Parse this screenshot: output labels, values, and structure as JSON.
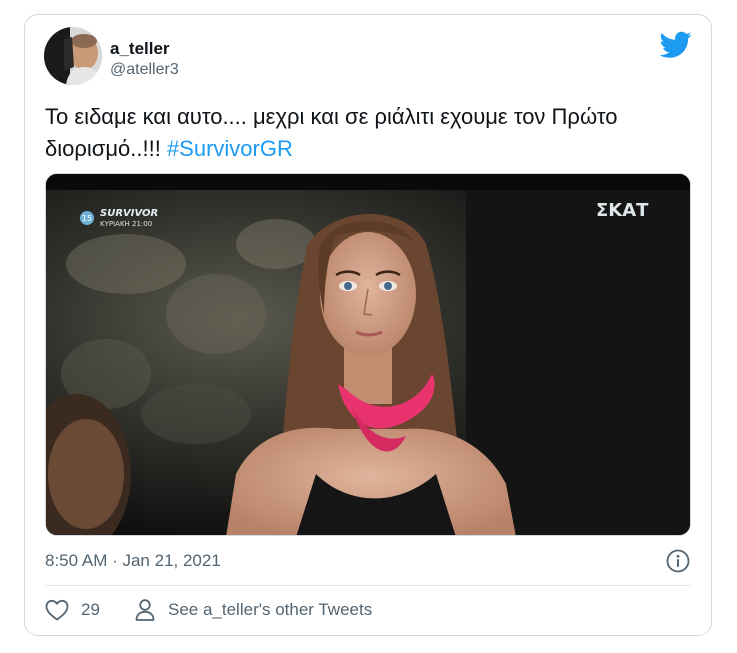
{
  "tweet": {
    "display_name": "a_teller",
    "handle": "@ateller3",
    "text_main": "Το ειδαμε και αυτο.... μεχρι και σε ριάλιτι εχουμε τον Πρώτο διορισμό..!!! ",
    "hashtag": "#SurvivorGR",
    "timestamp": "8:50 AM · Jan 21, 2021",
    "like_count": "29",
    "profile_link": "See a_teller's other Tweets"
  },
  "media": {
    "channel_logo": "ΣΚΑΤ",
    "rating_badge": "15",
    "show_title": "SURVIVOR",
    "show_schedule": "ΚΥΡΙΑΚΗ 21:00"
  },
  "icons": {
    "brand": "twitter-bird-icon",
    "info": "info-icon",
    "like": "heart-icon",
    "profile": "person-icon"
  },
  "colors": {
    "accent": "#1d9bf0",
    "text": "#0f1419",
    "secondary": "#536471",
    "border": "#cfd9de",
    "scarf": "#e8336e"
  }
}
